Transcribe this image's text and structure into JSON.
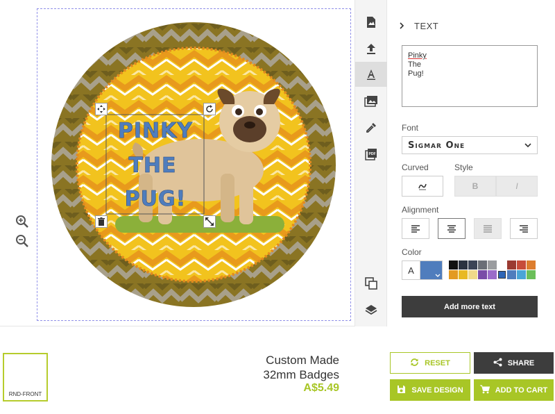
{
  "canvas": {
    "text_lines": [
      "PINKY",
      "THE",
      "PUG!"
    ],
    "text_color": "#4f7dbd"
  },
  "zoom": {
    "in_icon": "zoom-in-icon",
    "out_icon": "zoom-out-icon"
  },
  "tools": [
    {
      "name": "image-edit-icon"
    },
    {
      "name": "upload-icon"
    },
    {
      "name": "text-icon",
      "active": true
    },
    {
      "name": "photo-gallery-icon"
    },
    {
      "name": "eyedropper-icon"
    },
    {
      "name": "pdf-icon"
    },
    {
      "name": "duplicate-icon"
    },
    {
      "name": "layers-icon"
    }
  ],
  "panel": {
    "title": "TEXT",
    "text_value_line1": "Pinky",
    "text_value_rest": "\nThe\nPug!",
    "font_label": "Font",
    "font_value": "Sigmar One",
    "curved_label": "Curved",
    "style_label": "Style",
    "bold_label": "B",
    "italic_label": "I",
    "alignment_label": "Alignment",
    "color_label": "Color",
    "color_a": "A",
    "current_color": "#4f7dbd",
    "swatches": [
      "#111111",
      "#2b3240",
      "#3b4456",
      "#6a6e76",
      "#9a9c9f",
      "#ffffff",
      "#9b3a31",
      "#c74c3a",
      "#dd7d2e",
      "#e39a21",
      "#e8b923",
      "#f0d98a",
      "#7a4ca8",
      "#9b6cc9",
      "#2f67b8",
      "#4f7dbd",
      "#4aa5d6",
      "#6bbf5a"
    ],
    "selected_swatch": 14,
    "add_more_label": "Add more text"
  },
  "footer": {
    "thumb_label": "RND-FRONT",
    "product_line1": "Custom Made",
    "product_line2": "32mm Badges",
    "price": "A$5.49",
    "reset_label": "RESET",
    "share_label": "SHARE",
    "save_label": "SAVE DESIGN",
    "cart_label": "ADD TO CART"
  },
  "colors": {
    "accent": "#a8c626",
    "dark": "#3d3d3d"
  }
}
